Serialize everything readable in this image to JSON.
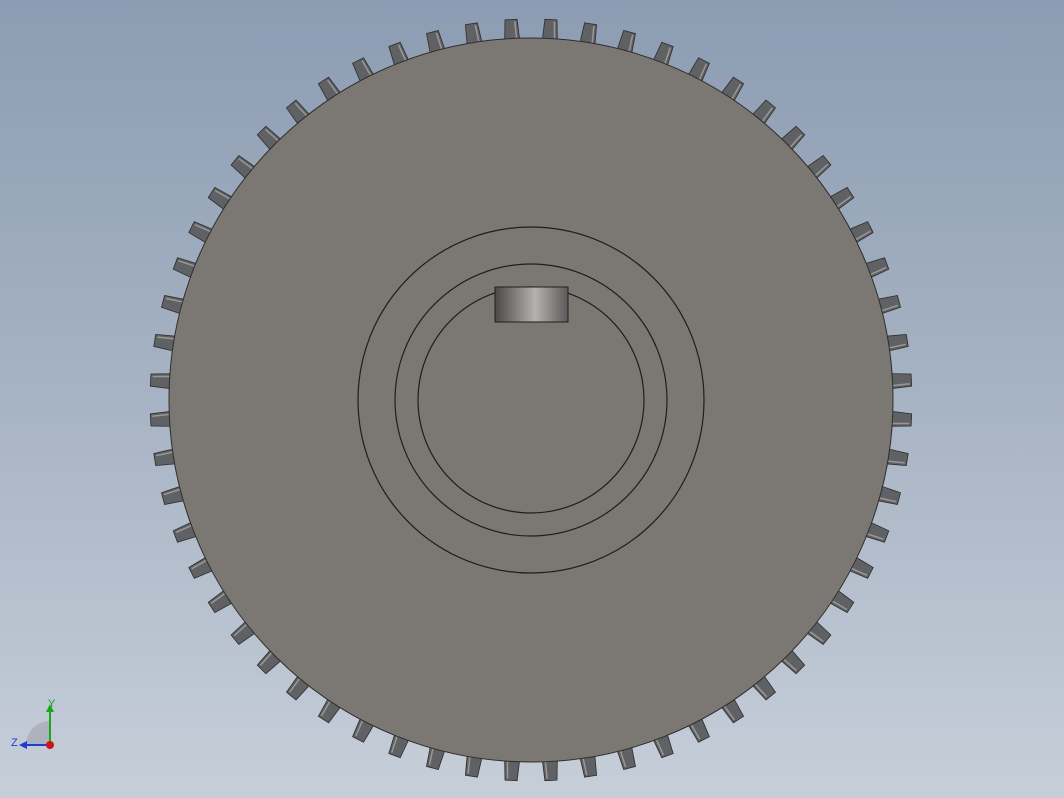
{
  "viewport": {
    "background_top": "#8c9cb2",
    "background_bottom": "#c6ced9",
    "part": {
      "name": "spur gear",
      "tooth_count": 60,
      "face_color": "#7b7773",
      "tooth_color": "#5f6165",
      "edge_color": "#2f2d2c",
      "keyway_color": "#8f8d8c"
    }
  },
  "triad": {
    "y_label": "Y",
    "z_label": "Z",
    "y_color": "#1aa81a",
    "z_color": "#1e3fd0",
    "x_color": "#d01414"
  }
}
